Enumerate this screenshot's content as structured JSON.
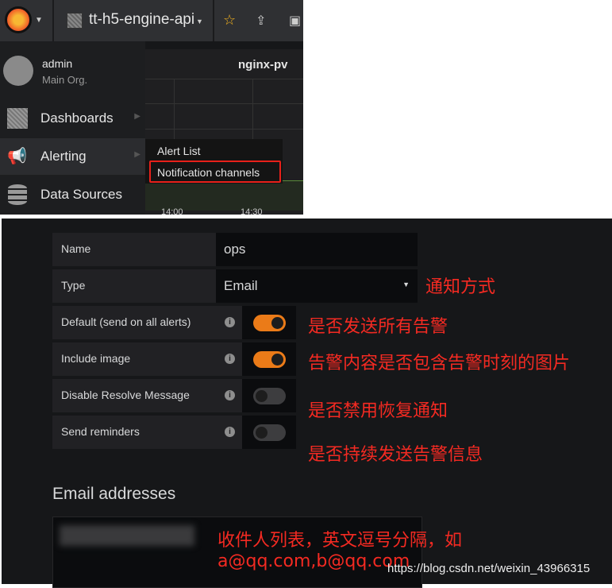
{
  "navbar": {
    "dashboard_title": "tt-h5-engine-api",
    "icons": [
      "grafana-logo",
      "dashboard-grid-icon",
      "star-icon",
      "share-icon",
      "save-icon"
    ]
  },
  "sidemenu": {
    "user": {
      "name": "admin",
      "org": "Main Org."
    },
    "items": [
      {
        "label": "Dashboards",
        "icon": "grid-icon"
      },
      {
        "label": "Alerting",
        "icon": "megaphone-icon"
      },
      {
        "label": "Data Sources",
        "icon": "database-icon"
      }
    ]
  },
  "panel": {
    "title": "nginx-pv",
    "x_ticks": [
      "14:00",
      "14:30"
    ]
  },
  "submenu": {
    "items": [
      "Alert List",
      "Notification channels"
    ]
  },
  "form": {
    "name_label": "Name",
    "name_value": "ops",
    "type_label": "Type",
    "type_value": "Email",
    "toggles": [
      {
        "label": "Default (send on all alerts)",
        "on": true
      },
      {
        "label": "Include image",
        "on": true
      },
      {
        "label": "Disable Resolve Message",
        "on": false
      },
      {
        "label": "Send reminders",
        "on": false
      }
    ],
    "email_heading": "Email addresses"
  },
  "annotations": {
    "type": "通知方式",
    "toggles": [
      "是否发送所有告警",
      "告警内容是否包含告警时刻的图片",
      "是否禁用恢复通知",
      "是否持续发送告警信息"
    ],
    "email_line1": "收件人列表，英文逗号分隔，如",
    "email_line2": "a@qq.com,b@qq.com"
  },
  "watermark": "https://blog.csdn.net/weixin_43966315",
  "colors": {
    "accent": "#eb7b18",
    "highlight_box": "#e8201a",
    "annotation": "#f42a22"
  }
}
